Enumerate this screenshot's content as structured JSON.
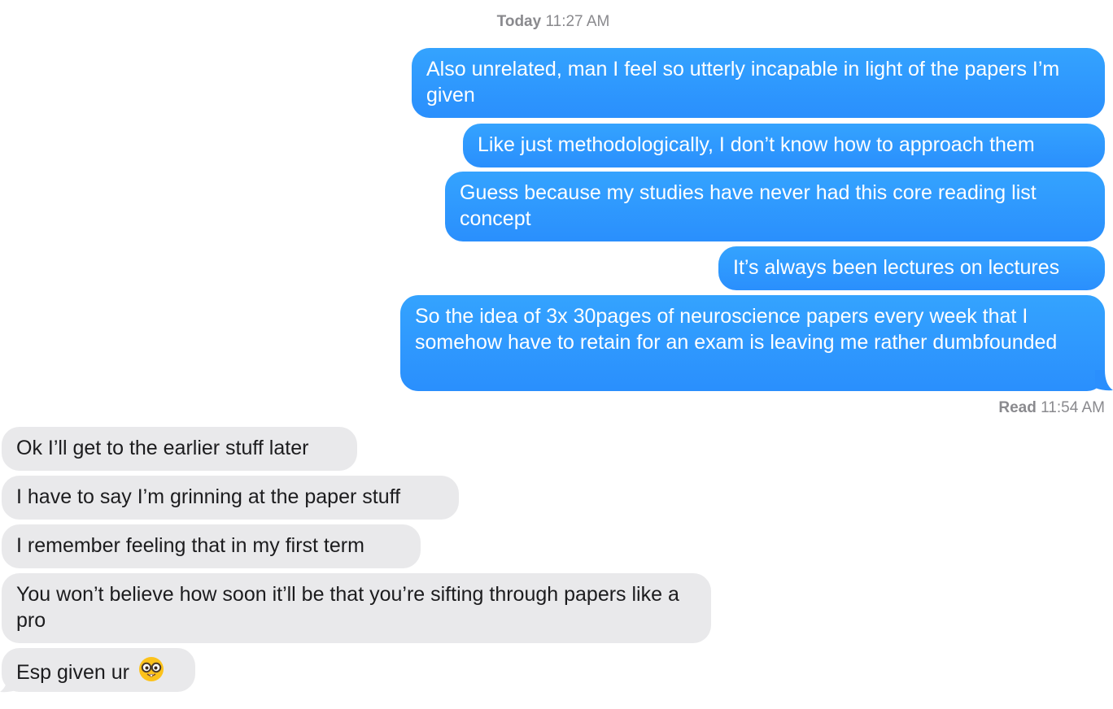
{
  "conversation": {
    "timestamp_day": "Today",
    "timestamp_time": "11:27 AM",
    "sent_messages": [
      "Also unrelated, man I feel so utterly incapable in light of the papers I’m given",
      "Like just methodologically, I don’t know how to approach them",
      "Guess because my studies have never had this core reading list concept",
      "It’s always been lectures on lectures",
      "So the idea of 3x 30pages of neuroscience papers every week that I somehow have to retain for an exam is leaving me rather dumbfounded"
    ],
    "read_label": "Read",
    "read_time": "11:54 AM",
    "received_messages": [
      "Ok I’ll get to the earlier stuff later",
      "I have to say I’m grinning at the paper stuff",
      "I remember feeling that in my first term",
      "You won’t believe how soon it’ll be that you’re sifting through papers like a pro",
      "Esp given ur"
    ],
    "received_last_emoji": "nerd-face-emoji",
    "colors": {
      "sent_bubble": "#2a8ffd",
      "received_bubble": "#e9e9eb",
      "meta_text": "#8a8a8e"
    }
  }
}
